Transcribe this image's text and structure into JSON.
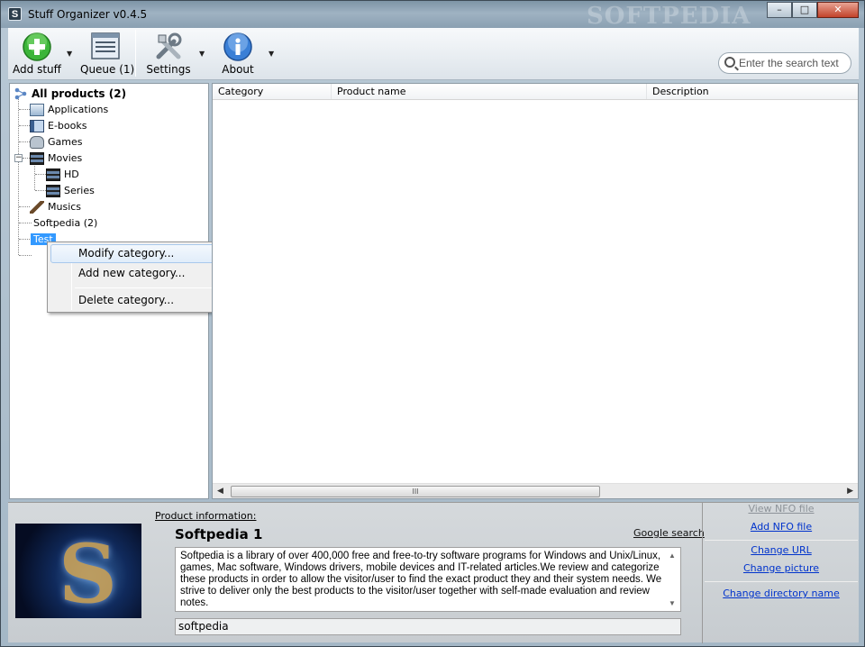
{
  "window": {
    "title": "Stuff Organizer v0.4.5",
    "app_icon_letter": "S",
    "watermark": "SOFTPEDIA",
    "controls": {
      "minimize": "–",
      "maximize": "□",
      "close": "✕"
    }
  },
  "toolbar": {
    "add_stuff": "Add stuff",
    "queue": "Queue (1)",
    "settings": "Settings",
    "about": "About",
    "dropdown_arrow": "▼"
  },
  "search": {
    "placeholder": "Enter the search text"
  },
  "tree": {
    "root": "All products (2)",
    "items": [
      {
        "label": "Applications",
        "icon": "applications-icon"
      },
      {
        "label": "E-books",
        "icon": "book-icon"
      },
      {
        "label": "Games",
        "icon": "gamepad-icon"
      },
      {
        "label": "Movies",
        "icon": "film-icon"
      },
      {
        "label": "HD",
        "icon": "film-icon"
      },
      {
        "label": "Series",
        "icon": "film-icon"
      },
      {
        "label": "Musics",
        "icon": "guitar-icon"
      },
      {
        "label": "Softpedia (2)"
      },
      {
        "label": "Test"
      }
    ],
    "expander": "−"
  },
  "context_menu": {
    "items": [
      "Modify category...",
      "Add new category...",
      "Delete category..."
    ]
  },
  "list": {
    "columns": [
      "Category",
      "Product name",
      "Description"
    ],
    "scroll_left": "◀",
    "scroll_right": "▶",
    "thumb_grip": "III"
  },
  "info": {
    "heading": "Product information:",
    "product_name": "Softpedia 1",
    "google_search": "Google search",
    "description": "Softpedia is a library of over 400,000 free and free-to-try software programs for Windows and Unix/Linux, games, Mac software, Windows drivers, mobile devices and IT-related articles.We review and categorize these products in order to allow the visitor/user to find the exact product they and their system needs. We strive to deliver only the best products to the visitor/user together with self-made evaluation and review notes.",
    "tags": "softpedia",
    "thumbnail_letter": "S",
    "scroll_up": "▲",
    "scroll_down": "▼",
    "links": {
      "view_nfo": "View NFO file",
      "add_nfo": "Add NFO file",
      "change_url": "Change URL",
      "change_picture": "Change picture",
      "change_directory": "Change directory name"
    }
  }
}
